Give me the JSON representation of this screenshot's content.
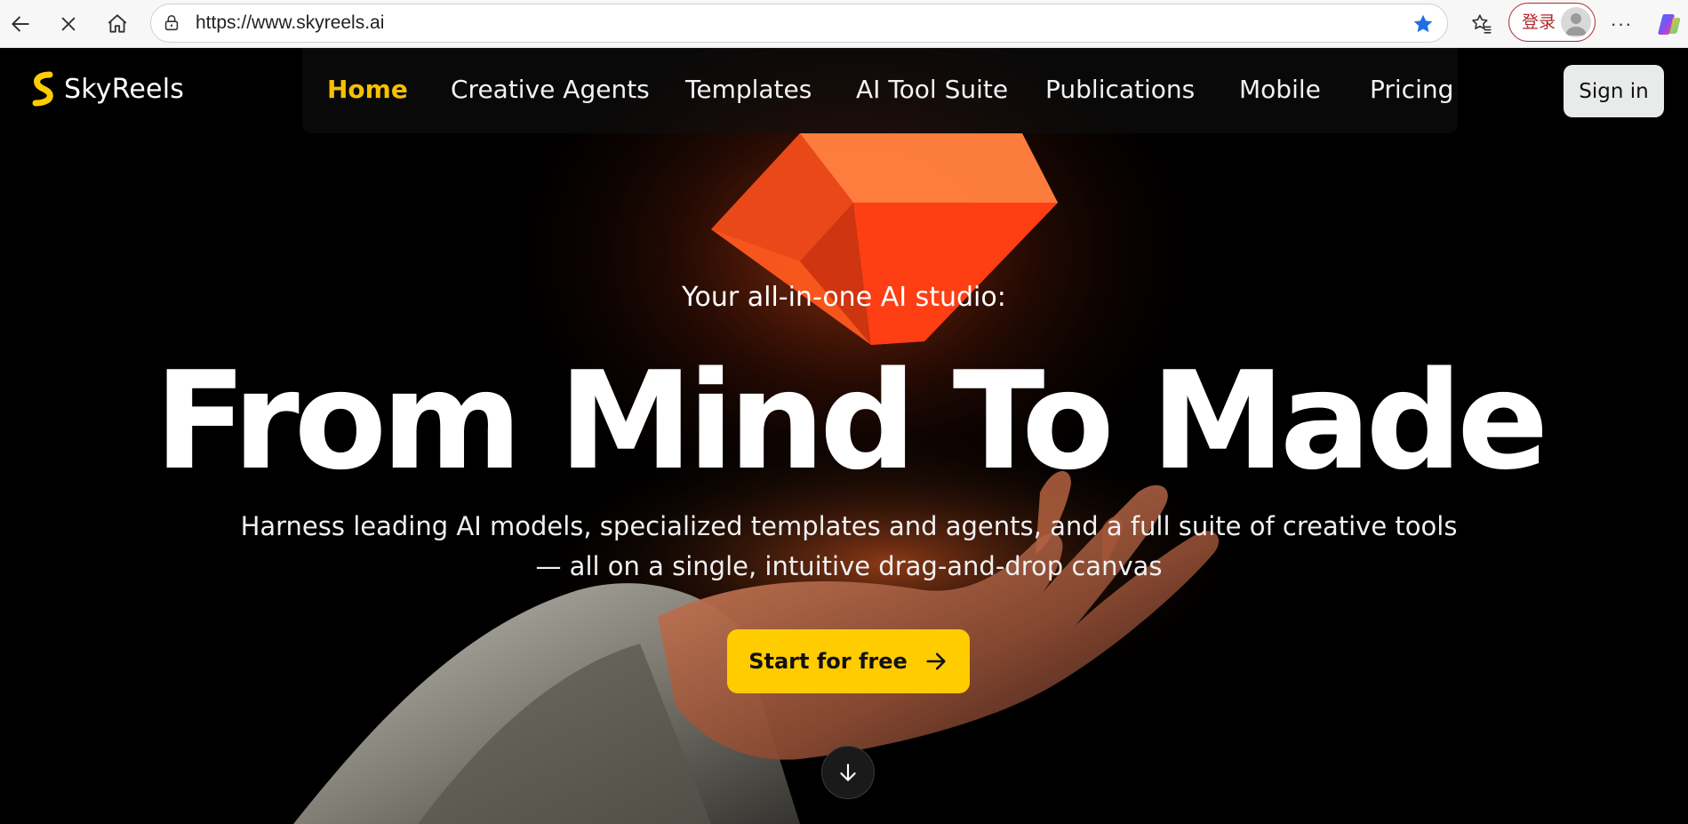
{
  "browser": {
    "url": "https://www.skyreels.ai",
    "login_label": "登录",
    "more_label": "···",
    "icons": {
      "back": "back-arrow-icon",
      "stop": "close-icon",
      "home": "home-icon",
      "site_info": "lock-icon",
      "favorite": "star-icon",
      "favorites": "favorites-icon",
      "profile": "avatar",
      "copilot": "copilot-icon"
    }
  },
  "site": {
    "logo_text": "SkyReels",
    "brand_color": "#ffcc00",
    "nav": {
      "items": [
        {
          "label": "Home",
          "active": true
        },
        {
          "label": "Creative Agents",
          "active": false
        },
        {
          "label": "Templates",
          "active": false
        },
        {
          "label": "AI Tool Suite",
          "active": false
        },
        {
          "label": "Publications",
          "active": false
        },
        {
          "label": "Mobile",
          "active": false
        },
        {
          "label": "Pricing",
          "active": false
        }
      ],
      "active_color": "#f5c000"
    },
    "signin_label": "Sign in"
  },
  "hero": {
    "eyebrow": "Your all-in-one AI studio:",
    "headline": "From Mind To Made",
    "subhead_line1": "Harness leading AI models, specialized templates and agents, and a full suite of creative tools",
    "subhead_line2": "— all on a single, intuitive drag-and-drop canvas",
    "cta_label": "Start for free",
    "cta_icon": "arrow-right-icon",
    "scroll_icon": "arrow-down-icon",
    "accent_color": "#ff5a1f"
  }
}
